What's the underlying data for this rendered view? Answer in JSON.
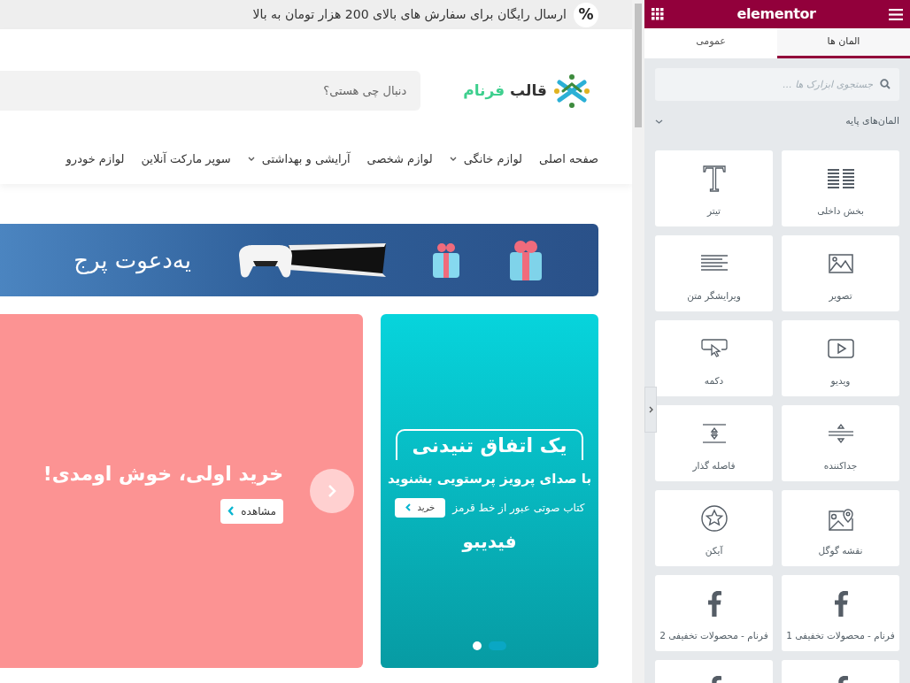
{
  "announcement": {
    "badge": "%",
    "text": "ارسال رایگان برای سفارش های بالای 200 هزار تومان به بالا"
  },
  "logo": {
    "word1": "قالب",
    "word2": "فرنام"
  },
  "search": {
    "placeholder": "دنبال چی هستی؟"
  },
  "nav": [
    {
      "label": "صفحه اصلی",
      "has_dropdown": false
    },
    {
      "label": "لوازم خانگی",
      "has_dropdown": true
    },
    {
      "label": "لوازم شخصی",
      "has_dropdown": false
    },
    {
      "label": "آرایشی و بهداشتی",
      "has_dropdown": true
    },
    {
      "label": "سوپر مارکت آنلاین",
      "has_dropdown": false
    },
    {
      "label": "لوازم خودرو",
      "has_dropdown": false
    }
  ],
  "promo_banner": {
    "text": "یه‌دعوت پرج"
  },
  "slider": {
    "title": "خرید اولی، خوش اومدی!",
    "button": "مشاهده"
  },
  "side_banner": {
    "headline": "یک اتفاق تنیدنی",
    "subtitle": "با صدای پرویز پرستویی بشنوید",
    "caption": "کتاب صوتی عبور از خط قرمز",
    "button": "خرید",
    "brand": "فیدیبو",
    "dots": [
      {
        "selected": false
      },
      {
        "selected": true
      }
    ]
  },
  "panel": {
    "brand": "elementor",
    "tabs": [
      {
        "label": "المان ها",
        "selected": true
      },
      {
        "label": "عمومی",
        "selected": false
      }
    ],
    "search": {
      "placeholder": "جستجوی ابزارک ها ..."
    },
    "category": {
      "label": "المان‌های پایه",
      "expanded": true
    },
    "widgets": [
      {
        "kind": "columns",
        "label": "بخش داخلی"
      },
      {
        "kind": "heading",
        "label": "تیتر"
      },
      {
        "kind": "image",
        "label": "تصویر"
      },
      {
        "kind": "text",
        "label": "ویرایشگر متن"
      },
      {
        "kind": "video",
        "label": "ویدیو"
      },
      {
        "kind": "button",
        "label": "دکمه"
      },
      {
        "kind": "divider",
        "label": "جداکننده"
      },
      {
        "kind": "spacer",
        "label": "فاصله گذار"
      },
      {
        "kind": "map",
        "label": "نقشه گوگل"
      },
      {
        "kind": "star",
        "label": "آیکن"
      },
      {
        "kind": "facebook",
        "label": "فرنام - محصولات تخفیفی 1"
      },
      {
        "kind": "facebook",
        "label": "فرنام - محصولات تخفیفی 2"
      },
      {
        "kind": "facebook"
      },
      {
        "kind": "facebook"
      }
    ]
  }
}
